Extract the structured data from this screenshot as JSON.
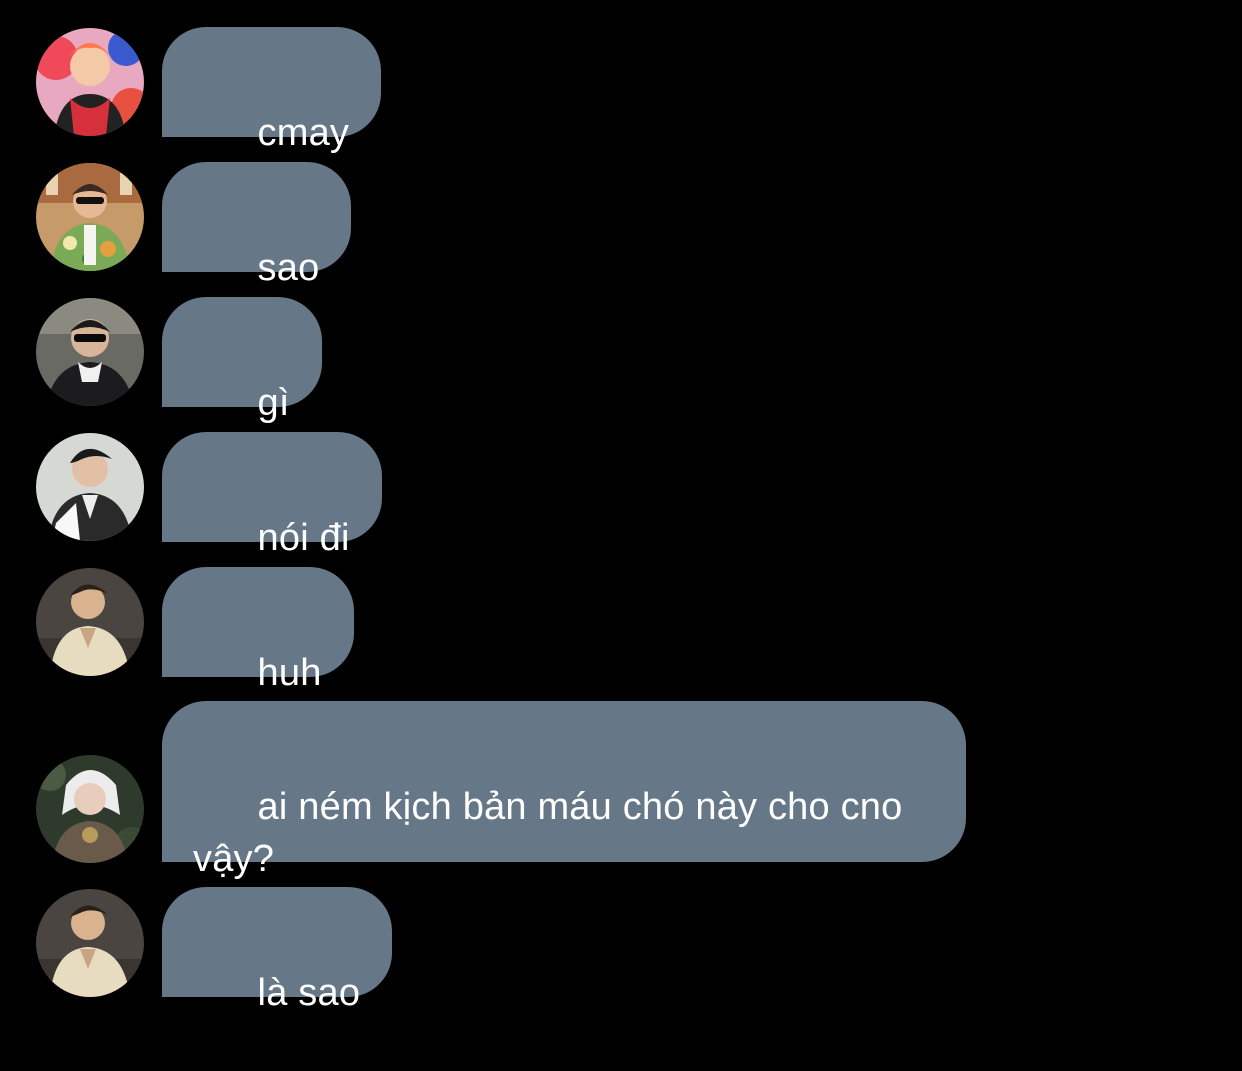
{
  "messages": [
    {
      "text": "cmay",
      "avatar_icon": "avatar-icon-red-hair"
    },
    {
      "text": "sao",
      "avatar_icon": "avatar-icon-sunglasses-floral-shirt"
    },
    {
      "text": "gì",
      "avatar_icon": "avatar-icon-sunglasses-dark"
    },
    {
      "text": "nói đi",
      "avatar_icon": "avatar-icon-dark-suit"
    },
    {
      "text": "huh",
      "avatar_icon": "avatar-icon-beige-shirt"
    },
    {
      "text": "ai ném kịch bản máu chó này cho cno vậy?",
      "avatar_icon": "avatar-icon-white-hair"
    },
    {
      "text": "là sao",
      "avatar_icon": "avatar-icon-beige-shirt"
    }
  ],
  "colors": {
    "background": "#000000",
    "bubble": "#667788",
    "text": "#ffffff"
  }
}
